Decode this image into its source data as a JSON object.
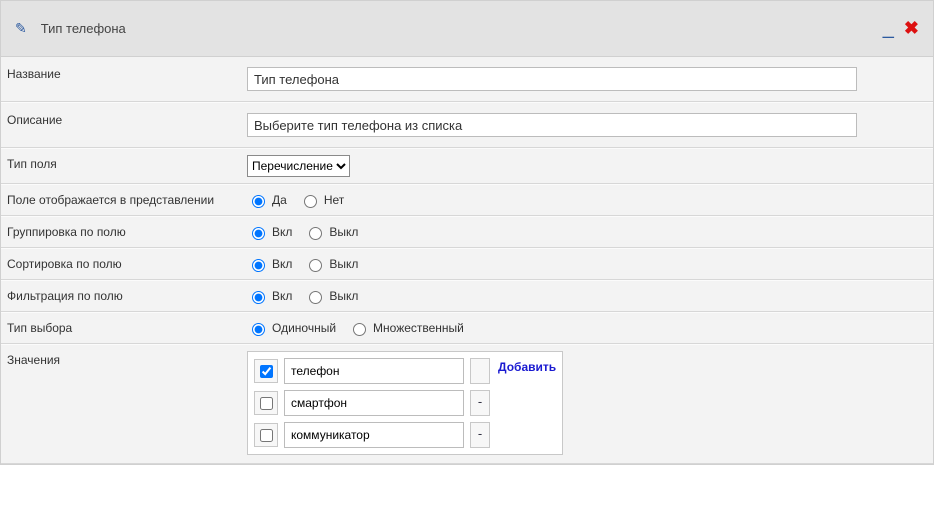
{
  "header": {
    "title": "Тип телефона"
  },
  "labels": {
    "name": "Название",
    "description": "Описание",
    "fieldType": "Тип поля",
    "showInView": "Поле отображается в представлении",
    "groupBy": "Группировка по полю",
    "sortBy": "Сортировка по полю",
    "filterBy": "Фильтрация по полю",
    "selectType": "Тип выбора",
    "values": "Значения"
  },
  "fields": {
    "name": "Тип телефона",
    "description": "Выберите тип телефона из списка",
    "fieldType": "Перечисление"
  },
  "radios": {
    "yes": "Да",
    "no": "Нет",
    "on": "Вкл",
    "off": "Выкл",
    "single": "Одиночный",
    "multiple": "Множественный"
  },
  "values": {
    "addLabel": "Добавить",
    "items": [
      {
        "label": "телефон",
        "checked": true,
        "removeEnabled": false
      },
      {
        "label": "смартфон",
        "checked": false,
        "removeEnabled": true
      },
      {
        "label": "коммуникатор",
        "checked": false,
        "removeEnabled": true
      }
    ]
  }
}
